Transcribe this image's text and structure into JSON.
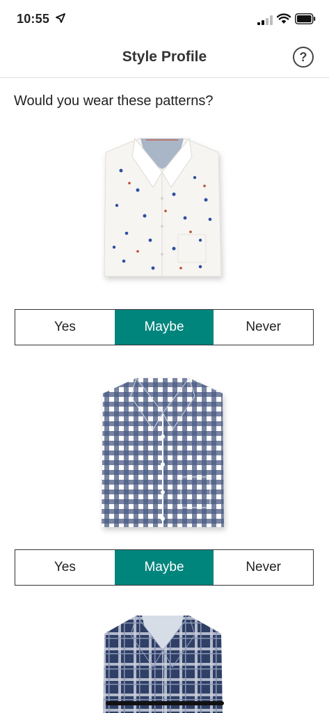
{
  "status_bar": {
    "time": "10:55"
  },
  "nav": {
    "title": "Style Profile",
    "help_label": "?"
  },
  "question": "Would you wear these patterns?",
  "items": [
    {
      "pattern": "white-floral-print-shirt",
      "options": [
        "Yes",
        "Maybe",
        "Never"
      ],
      "selected": "Maybe"
    },
    {
      "pattern": "navy-gingham-shirt",
      "options": [
        "Yes",
        "Maybe",
        "Never"
      ],
      "selected": "Maybe"
    },
    {
      "pattern": "navy-plaid-shirt"
    }
  ],
  "colors": {
    "accent": "#00857d",
    "border": "#333333",
    "text": "#222222"
  }
}
